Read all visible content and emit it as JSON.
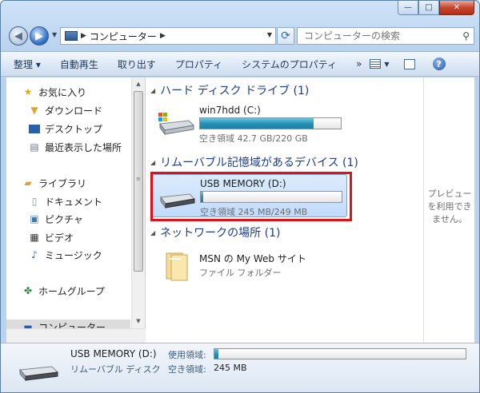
{
  "window": {
    "minimize_glyph": "—",
    "maximize_glyph": "□",
    "close_glyph": "✕"
  },
  "address": {
    "path": "コンピューター",
    "search_placeholder": "コンピューターの検索"
  },
  "toolbar": {
    "organize": "整理 ▾",
    "autoplay": "自動再生",
    "eject": "取り出す",
    "properties": "プロパティ",
    "system_properties": "システムのプロパティ",
    "more": "»"
  },
  "nav": {
    "favorites": "お気に入り",
    "downloads": "ダウンロード",
    "desktop": "デスクトップ",
    "recent": "最近表示した場所",
    "libraries": "ライブラリ",
    "documents": "ドキュメント",
    "pictures": "ピクチャ",
    "videos": "ビデオ",
    "music": "ミュージック",
    "homegroup": "ホームグループ",
    "computer": "コンピューター"
  },
  "groups": {
    "hdd": "ハード ディスク ドライブ (1)",
    "removable": "リムーバブル記憶域があるデバイス (1)",
    "network": "ネットワークの場所 (1)"
  },
  "drives": {
    "c": {
      "name": "win7hdd (C:)",
      "info": "空き領域 42.7 GB/220 GB",
      "used_fraction": 0.806
    },
    "d": {
      "name": "USB MEMORY (D:)",
      "info": "空き領域 245 MB/249 MB",
      "used_fraction": 0.016
    }
  },
  "network_item": {
    "name": "MSN の My Web サイト",
    "type": "ファイル フォルダー"
  },
  "preview": {
    "line1": "プレビュー",
    "line2": "を利用でき",
    "line3": "ません。"
  },
  "details": {
    "name": "USB MEMORY (D:)",
    "type": "リムーバブル ディスク",
    "used_label": "使用領域:",
    "free_label": "空き領域:",
    "free_value": "245 MB",
    "used_fraction": 0.016
  },
  "colors": {
    "selection_outline": "#e0111a",
    "group_header": "#1e3c8c",
    "drive_fill": "#2792b5"
  }
}
